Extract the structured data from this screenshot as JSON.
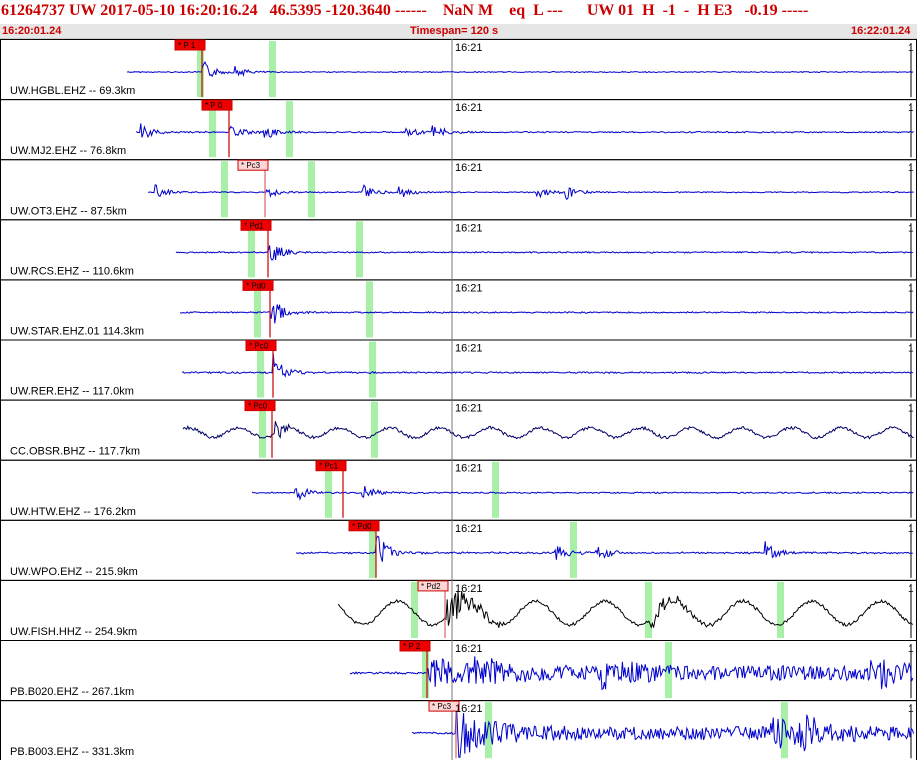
{
  "header": {
    "title": "61264737 UW 2017-05-10 16:20:16.24   46.5395 -120.3640 ------    NaN M    eq  L ---      UW 01  H  -1  -  H E3   -0.19 -----",
    "start_time": "16:20:01.24",
    "timespan": "Timespan= 120 s",
    "end_time": "16:22:01.24",
    "colors": {
      "text": "#cc0000",
      "bar": "#e6e6e6"
    }
  },
  "minute_label": "16:21",
  "right_tick": "1",
  "traces": [
    {
      "station": "UW.HGBL.EHZ -- 69.3km",
      "pick": "* P 1",
      "pick_style": "red",
      "color": "#0000cc",
      "amp": 0.35
    },
    {
      "station": "UW.MJ2.EHZ -- 76.8km",
      "pick": "* P 0",
      "pick_style": "red",
      "color": "#0000cc",
      "amp": 0.5
    },
    {
      "station": "UW.OT3.EHZ -- 87.5km",
      "pick": "* Pc3",
      "pick_style": "pink",
      "color": "#0000cc",
      "amp": 0.4
    },
    {
      "station": "UW.RCS.EHZ -- 110.6km",
      "pick": "* Pd1",
      "pick_style": "red",
      "color": "#0000cc",
      "amp": 0.5
    },
    {
      "station": "UW.STAR.EHZ.01 114.3km",
      "pick": "* Pd0",
      "pick_style": "red",
      "color": "#0000cc",
      "amp": 0.5
    },
    {
      "station": "UW.RER.EHZ -- 117.0km",
      "pick": "* Pc0",
      "pick_style": "red",
      "color": "#0000cc",
      "amp": 0.55
    },
    {
      "station": "CC.OBSR.BHZ -- 117.7km",
      "pick": "* Pc0",
      "pick_style": "red",
      "color": "#000066",
      "amp": 0.7
    },
    {
      "station": "UW.HTW.EHZ -- 176.2km",
      "pick": "* Pc1",
      "pick_style": "red",
      "color": "#0000cc",
      "amp": 0.5
    },
    {
      "station": "UW.WPO.EHZ -- 215.9km",
      "pick": "* Pd0",
      "pick_style": "red",
      "color": "#0000cc",
      "amp": 0.6
    },
    {
      "station": "UW.FISH.HHZ -- 254.9km",
      "pick": "* Pd2",
      "pick_style": "pink",
      "color": "#000000",
      "amp": 0.7
    },
    {
      "station": "PB.B020.EHZ -- 267.1km",
      "pick": "* P 2",
      "pick_style": "red",
      "color": "#0000cc",
      "amp": 0.75
    },
    {
      "station": "PB.B003.EHZ -- 331.3km",
      "pick": "* Pc3",
      "pick_style": "pink",
      "color": "#0000cc",
      "amp": 0.7
    }
  ]
}
